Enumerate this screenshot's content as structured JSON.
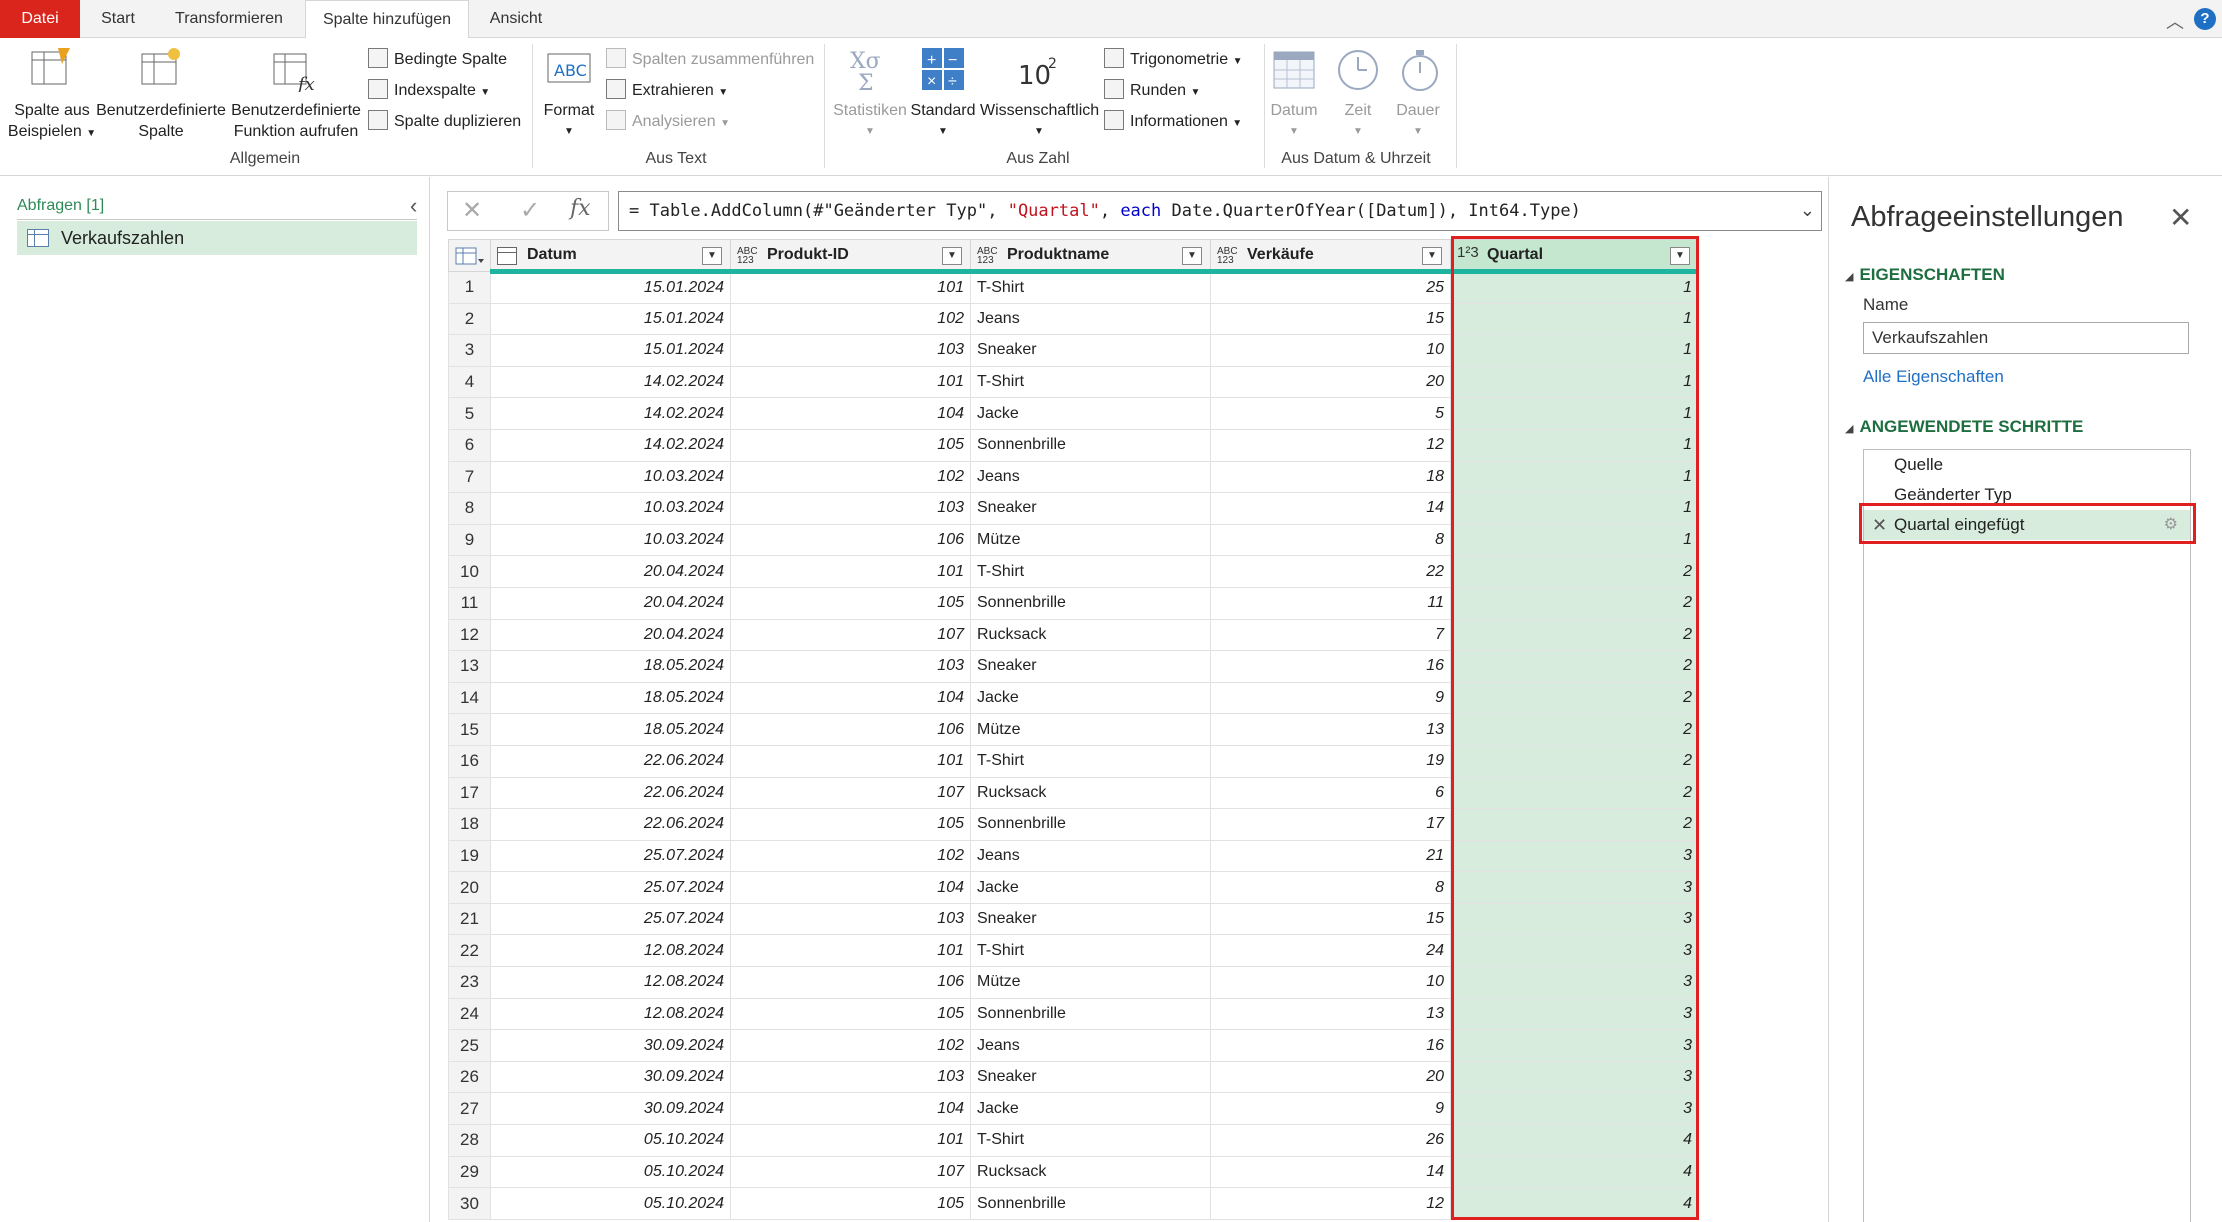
{
  "tabs": [
    {
      "label": "Datei"
    },
    {
      "label": "Start"
    },
    {
      "label": "Transformieren"
    },
    {
      "label": "Spalte hinzufügen"
    },
    {
      "label": "Ansicht"
    }
  ],
  "ribbon": {
    "allgemein": {
      "label": "Allgemein",
      "spalte_aus_beispielen_1": "Spalte aus",
      "spalte_aus_beispielen_2": "Beispielen",
      "benutzerdef_spalte_1": "Benutzerdefinierte",
      "benutzerdef_spalte_2": "Spalte",
      "benutzerdef_funktion_1": "Benutzerdefinierte",
      "benutzerdef_funktion_2": "Funktion aufrufen",
      "bedingte_spalte": "Bedingte Spalte",
      "indexspalte": "Indexspalte",
      "spalte_duplizieren": "Spalte duplizieren"
    },
    "aus_text": {
      "label": "Aus Text",
      "format": "Format",
      "spalten_zusammenfuehren": "Spalten zusammenführen",
      "extrahieren": "Extrahieren",
      "analysieren": "Analysieren"
    },
    "aus_zahl": {
      "label": "Aus Zahl",
      "statistiken": "Statistiken",
      "standard": "Standard",
      "wissenschaftlich": "Wissenschaftlich",
      "trigonometrie": "Trigonometrie",
      "runden": "Runden",
      "informationen": "Informationen"
    },
    "aus_datum": {
      "label": "Aus Datum & Uhrzeit",
      "datum": "Datum",
      "zeit": "Zeit",
      "dauer": "Dauer"
    }
  },
  "queries": {
    "title": "Abfragen [1]",
    "items": [
      {
        "label": "Verkaufszahlen"
      }
    ]
  },
  "formula": {
    "prefix": "= Table.AddColumn(#\"Geänderter Typ\", ",
    "str1": "\"Quartal\"",
    "sep": ", ",
    "kw": "each",
    "suffix": " Date.QuarterOfYear([Datum]), Int64.Type)"
  },
  "grid": {
    "columns": [
      {
        "name": "Datum",
        "type": "date"
      },
      {
        "name": "Produkt-ID",
        "type": "ABC 123"
      },
      {
        "name": "Produktname",
        "type": "ABC 123"
      },
      {
        "name": "Verkäufe",
        "type": "ABC 123"
      },
      {
        "name": "Quartal",
        "type": "1²3"
      }
    ],
    "rows": [
      [
        "1",
        "15.01.2024",
        "101",
        "T-Shirt",
        "25",
        "1"
      ],
      [
        "2",
        "15.01.2024",
        "102",
        "Jeans",
        "15",
        "1"
      ],
      [
        "3",
        "15.01.2024",
        "103",
        "Sneaker",
        "10",
        "1"
      ],
      [
        "4",
        "14.02.2024",
        "101",
        "T-Shirt",
        "20",
        "1"
      ],
      [
        "5",
        "14.02.2024",
        "104",
        "Jacke",
        "5",
        "1"
      ],
      [
        "6",
        "14.02.2024",
        "105",
        "Sonnenbrille",
        "12",
        "1"
      ],
      [
        "7",
        "10.03.2024",
        "102",
        "Jeans",
        "18",
        "1"
      ],
      [
        "8",
        "10.03.2024",
        "103",
        "Sneaker",
        "14",
        "1"
      ],
      [
        "9",
        "10.03.2024",
        "106",
        "Mütze",
        "8",
        "1"
      ],
      [
        "10",
        "20.04.2024",
        "101",
        "T-Shirt",
        "22",
        "2"
      ],
      [
        "11",
        "20.04.2024",
        "105",
        "Sonnenbrille",
        "11",
        "2"
      ],
      [
        "12",
        "20.04.2024",
        "107",
        "Rucksack",
        "7",
        "2"
      ],
      [
        "13",
        "18.05.2024",
        "103",
        "Sneaker",
        "16",
        "2"
      ],
      [
        "14",
        "18.05.2024",
        "104",
        "Jacke",
        "9",
        "2"
      ],
      [
        "15",
        "18.05.2024",
        "106",
        "Mütze",
        "13",
        "2"
      ],
      [
        "16",
        "22.06.2024",
        "101",
        "T-Shirt",
        "19",
        "2"
      ],
      [
        "17",
        "22.06.2024",
        "107",
        "Rucksack",
        "6",
        "2"
      ],
      [
        "18",
        "22.06.2024",
        "105",
        "Sonnenbrille",
        "17",
        "2"
      ],
      [
        "19",
        "25.07.2024",
        "102",
        "Jeans",
        "21",
        "3"
      ],
      [
        "20",
        "25.07.2024",
        "104",
        "Jacke",
        "8",
        "3"
      ],
      [
        "21",
        "25.07.2024",
        "103",
        "Sneaker",
        "15",
        "3"
      ],
      [
        "22",
        "12.08.2024",
        "101",
        "T-Shirt",
        "24",
        "3"
      ],
      [
        "23",
        "12.08.2024",
        "106",
        "Mütze",
        "10",
        "3"
      ],
      [
        "24",
        "12.08.2024",
        "105",
        "Sonnenbrille",
        "13",
        "3"
      ],
      [
        "25",
        "30.09.2024",
        "102",
        "Jeans",
        "16",
        "3"
      ],
      [
        "26",
        "30.09.2024",
        "103",
        "Sneaker",
        "20",
        "3"
      ],
      [
        "27",
        "30.09.2024",
        "104",
        "Jacke",
        "9",
        "3"
      ],
      [
        "28",
        "05.10.2024",
        "101",
        "T-Shirt",
        "26",
        "4"
      ],
      [
        "29",
        "05.10.2024",
        "107",
        "Rucksack",
        "14",
        "4"
      ],
      [
        "30",
        "05.10.2024",
        "105",
        "Sonnenbrille",
        "12",
        "4"
      ]
    ]
  },
  "settings": {
    "title": "Abfrageeinstellungen",
    "properties_header": "EIGENSCHAFTEN",
    "name_label": "Name",
    "name_value": "Verkaufszahlen",
    "all_properties": "Alle Eigenschaften",
    "steps_header": "ANGEWENDETE SCHRITTE",
    "steps": [
      {
        "label": "Quelle"
      },
      {
        "label": "Geänderter Typ"
      },
      {
        "label": "Quartal eingefügt"
      }
    ]
  },
  "colors": {
    "file_tab": "#d9251c",
    "accent_green": "#1e6e3f",
    "selection_green": "#d7ecdc",
    "highlight_red": "#e02020",
    "header_underline": "#1eb4a0"
  }
}
